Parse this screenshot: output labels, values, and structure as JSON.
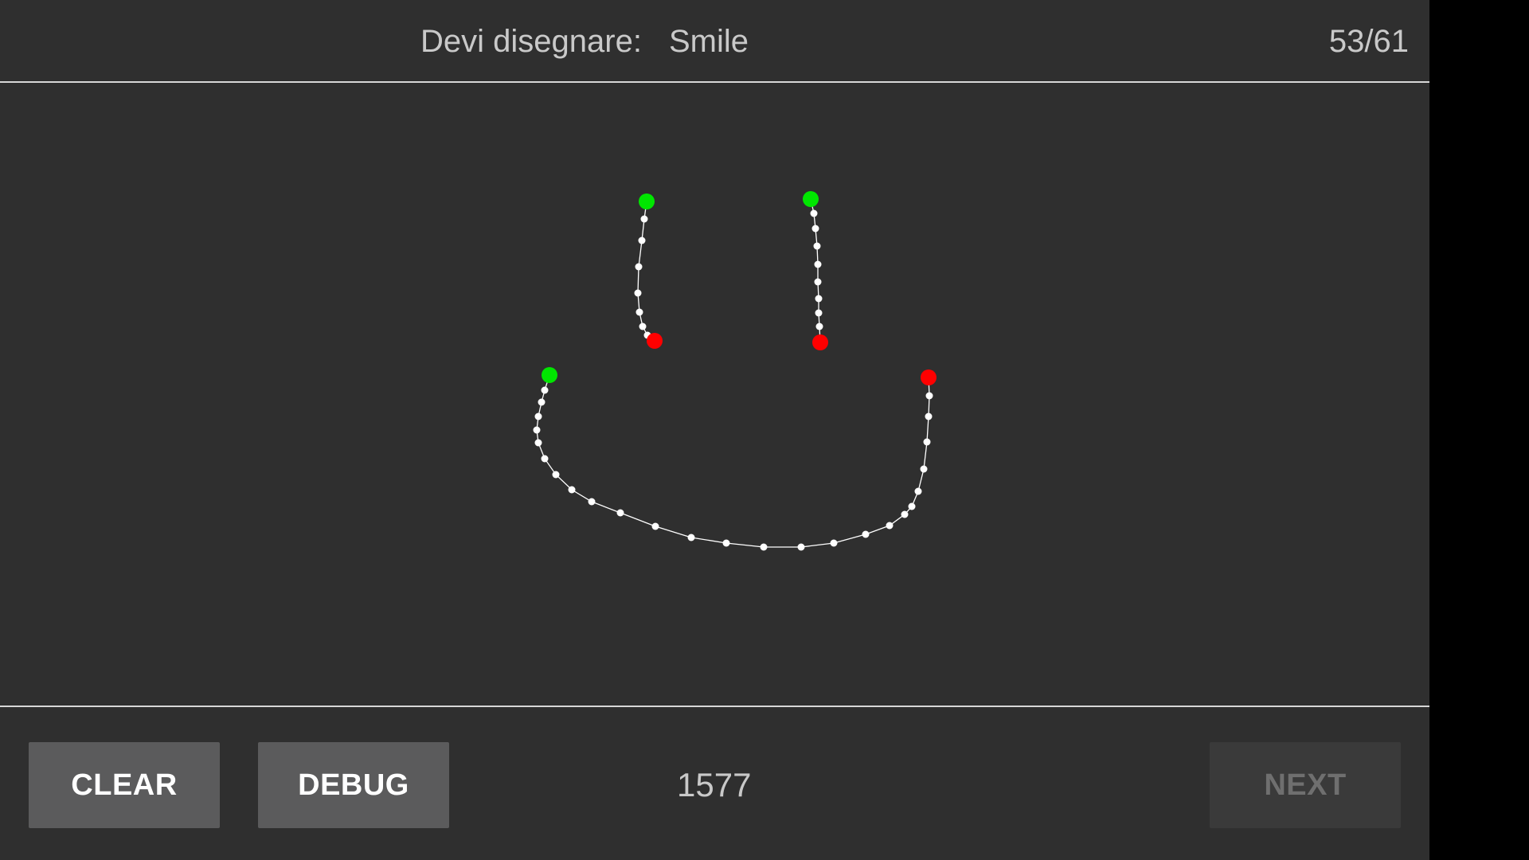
{
  "header": {
    "prompt_label": "Devi disegnare:",
    "target_word": "Smile",
    "progress": "53/61"
  },
  "footer": {
    "clear_label": "CLEAR",
    "debug_label": "DEBUG",
    "score": "1577",
    "next_label": "NEXT",
    "next_enabled": false
  },
  "colors": {
    "background": "#2f2f2f",
    "stroke": "#ffffff",
    "start_point": "#00e600",
    "end_point": "#ff0000",
    "button": "#5b5b5c",
    "button_disabled": "#3a3a3a"
  },
  "strokes": [
    {
      "name": "left-eye"
    },
    {
      "name": "right-eye"
    },
    {
      "name": "mouth"
    }
  ]
}
